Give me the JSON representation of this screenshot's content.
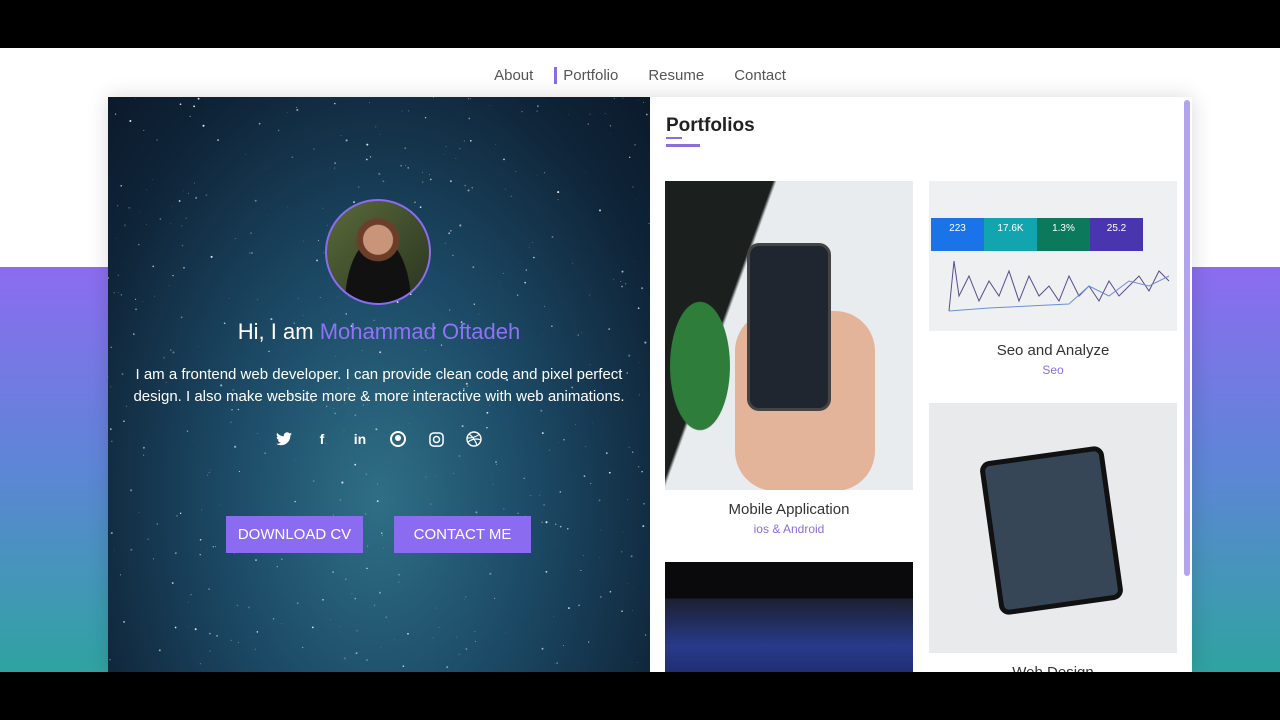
{
  "nav": {
    "items": [
      {
        "label": "About"
      },
      {
        "label": "Portfolio",
        "active": true
      },
      {
        "label": "Resume"
      },
      {
        "label": "Contact"
      }
    ]
  },
  "profile": {
    "greeting": "Hi, I am",
    "name": "Mohammad Oftadeh",
    "description": "I am a frontend web developer. I can provide clean code and pixel perfect design. I also make website more & more interactive with web animations.",
    "social": [
      "twitter-icon",
      "facebook-icon",
      "linkedin-icon",
      "github-icon",
      "instagram-icon",
      "dribbble-icon"
    ],
    "buttons": {
      "download": "DOWNLOAD CV",
      "contact": "CONTACT ME"
    }
  },
  "portfolio": {
    "title": "Portfolios",
    "items": [
      {
        "title": "Mobile Application",
        "subtitle": "ios & Android"
      },
      {
        "title": "Seo and Analyze",
        "subtitle": "Seo",
        "tiles": [
          "223",
          "17.6K",
          "1.3%",
          "25.2"
        ]
      },
      {
        "title": "Web Design"
      }
    ]
  },
  "colors": {
    "accent": "#8b6cf0",
    "gradient_bottom": "#2fa3a0"
  }
}
